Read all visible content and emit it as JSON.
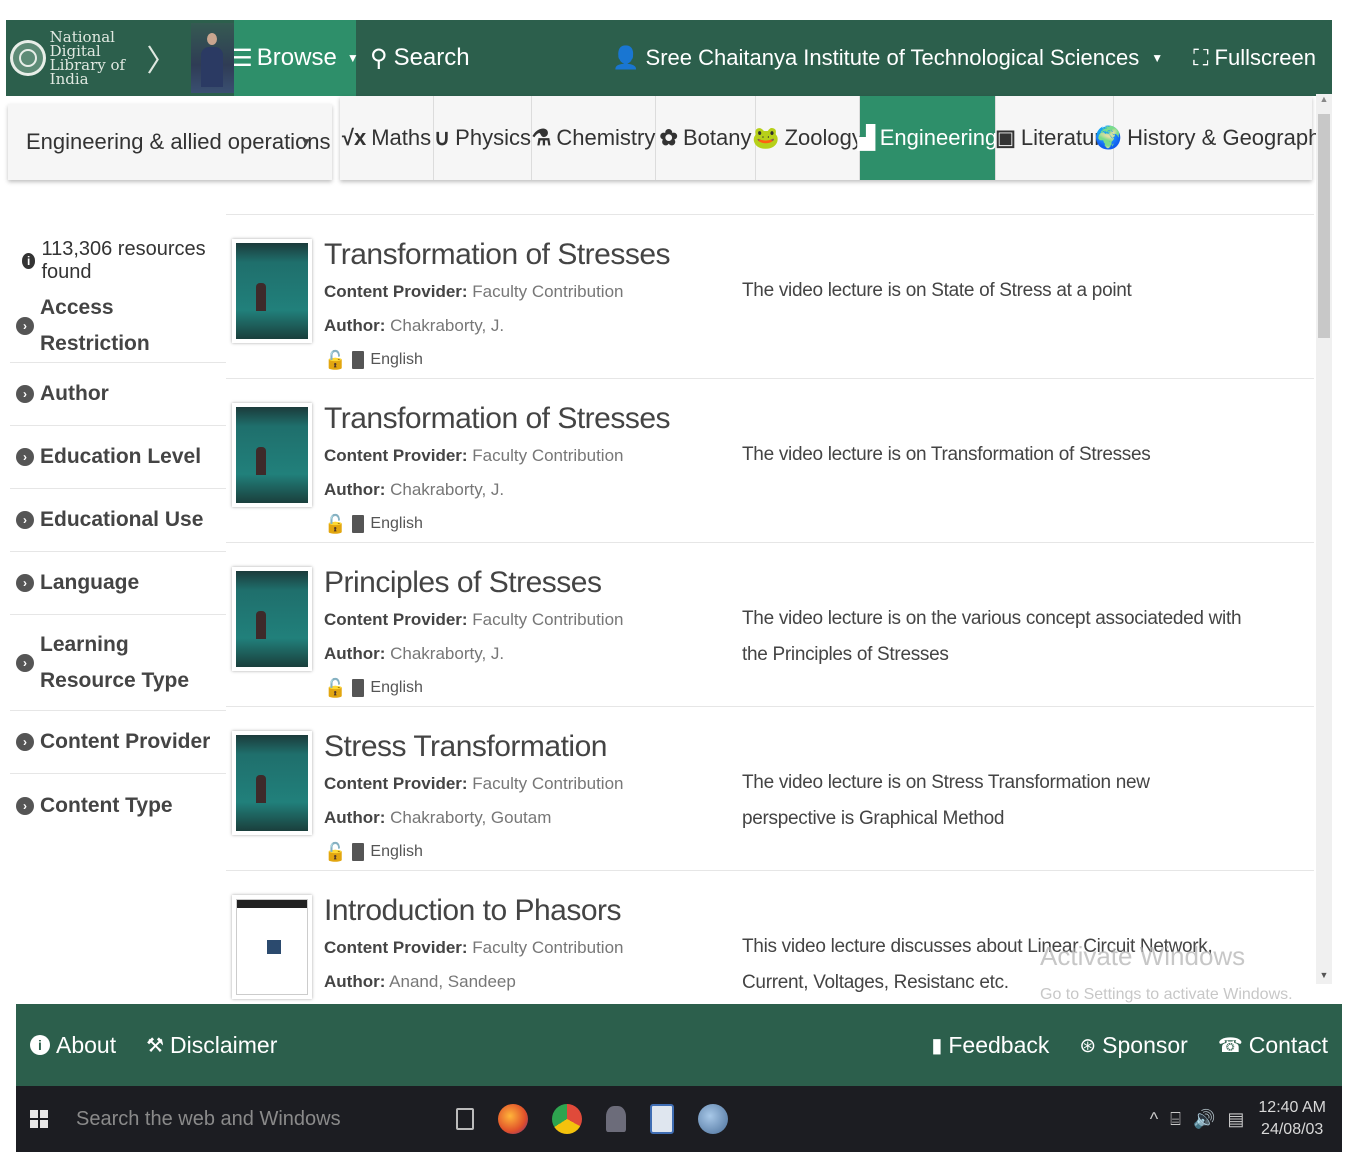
{
  "navbar": {
    "logo_text": "National Digital Library of India",
    "browse_label": "Browse",
    "search_label": "Search",
    "institution": "Sree Chaitanya Institute of Technological Sciences",
    "fullscreen_label": "Fullscreen"
  },
  "subject_select": {
    "value": "Engineering & allied operations"
  },
  "tabs": [
    {
      "label": "Maths",
      "icon": "sqrt-icon"
    },
    {
      "label": "Physics",
      "icon": "magnet-icon"
    },
    {
      "label": "Chemistry",
      "icon": "flask-icon"
    },
    {
      "label": "Botany",
      "icon": "plant-icon"
    },
    {
      "label": "Zoology",
      "icon": "frog-icon"
    },
    {
      "label": "Engineering",
      "icon": "factory-icon",
      "active": true
    },
    {
      "label": "Literature",
      "icon": "book-icon"
    },
    {
      "label": "History & Geography",
      "icon": "globe-icon"
    }
  ],
  "sidebar": {
    "found_count": "113,306 resources found",
    "filters": [
      "Access Restriction",
      "Author",
      "Education Level",
      "Educational Use",
      "Language",
      "Learning Resource Type",
      "Content Provider",
      "Content Type"
    ]
  },
  "labels": {
    "content_provider": "Content Provider:",
    "author": "Author:"
  },
  "results": [
    {
      "title": "Transformation of Stresses",
      "provider": "Faculty Contribution",
      "author": "Chakraborty, J.",
      "language": "English",
      "description": "The video lecture is on State of Stress at a point"
    },
    {
      "title": "Transformation of Stresses",
      "provider": "Faculty Contribution",
      "author": "Chakraborty, J.",
      "language": "English",
      "description": "The video lecture is on Transformation of Stresses"
    },
    {
      "title": "Principles of Stresses",
      "provider": "Faculty Contribution",
      "author": "Chakraborty, J.",
      "language": "English",
      "description": "The video lecture is on the various concept associateded with the Principles of Stresses"
    },
    {
      "title": "Stress Transformation",
      "provider": "Faculty Contribution",
      "author": "Chakraborty, Goutam",
      "language": "English",
      "description": "The video lecture is on Stress Transformation new perspective is Graphical Method"
    },
    {
      "title": "Introduction to Phasors",
      "provider": "Faculty Contribution",
      "author": "Anand, Sandeep",
      "language": "",
      "description": "This video lecture discusses about Linear Circuit Network, Current, Voltages, Resistanc etc."
    }
  ],
  "watermark": {
    "title": "Activate Windows",
    "subtitle": "Go to Settings to activate Windows."
  },
  "footer": {
    "about": "About",
    "disclaimer": "Disclaimer",
    "feedback": "Feedback",
    "sponsor": "Sponsor",
    "contact": "Contact"
  },
  "taskbar": {
    "search_placeholder": "Search the web and Windows",
    "time": "12:40 AM",
    "date": "24/08/03"
  },
  "colors": {
    "primary": "#2c5f4c",
    "accent": "#2e8f6a",
    "taskbar": "#1c1d22"
  }
}
